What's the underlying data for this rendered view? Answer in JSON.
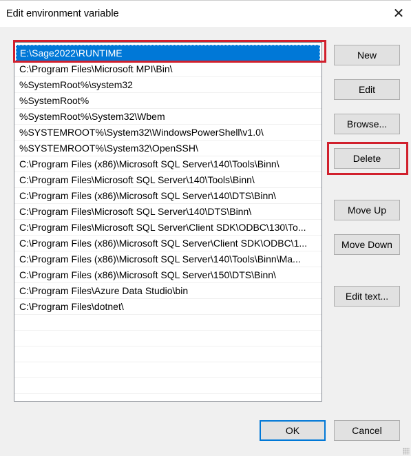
{
  "dialog": {
    "title": "Edit environment variable",
    "close_icon": "close-icon"
  },
  "list": {
    "selected_index": 0,
    "items": [
      "E:\\Sage2022\\RUNTIME",
      "C:\\Program Files\\Microsoft MPI\\Bin\\",
      "%SystemRoot%\\system32",
      "%SystemRoot%",
      "%SystemRoot%\\System32\\Wbem",
      "%SYSTEMROOT%\\System32\\WindowsPowerShell\\v1.0\\",
      "%SYSTEMROOT%\\System32\\OpenSSH\\",
      "C:\\Program Files (x86)\\Microsoft SQL Server\\140\\Tools\\Binn\\",
      "C:\\Program Files\\Microsoft SQL Server\\140\\Tools\\Binn\\",
      "C:\\Program Files (x86)\\Microsoft SQL Server\\140\\DTS\\Binn\\",
      "C:\\Program Files\\Microsoft SQL Server\\140\\DTS\\Binn\\",
      "C:\\Program Files\\Microsoft SQL Server\\Client SDK\\ODBC\\130\\To...",
      "C:\\Program Files (x86)\\Microsoft SQL Server\\Client SDK\\ODBC\\1...",
      "C:\\Program Files (x86)\\Microsoft SQL Server\\140\\Tools\\Binn\\Ma...",
      "C:\\Program Files (x86)\\Microsoft SQL Server\\150\\DTS\\Binn\\",
      "C:\\Program Files\\Azure Data Studio\\bin",
      "C:\\Program Files\\dotnet\\",
      "",
      "",
      "",
      "",
      ""
    ]
  },
  "buttons": {
    "new": "New",
    "edit": "Edit",
    "browse": "Browse...",
    "delete": "Delete",
    "move_up": "Move Up",
    "move_down": "Move Down",
    "edit_text": "Edit text...",
    "ok": "OK",
    "cancel": "Cancel"
  },
  "highlight_color": "#d1202d",
  "selection_color": "#0078d7"
}
